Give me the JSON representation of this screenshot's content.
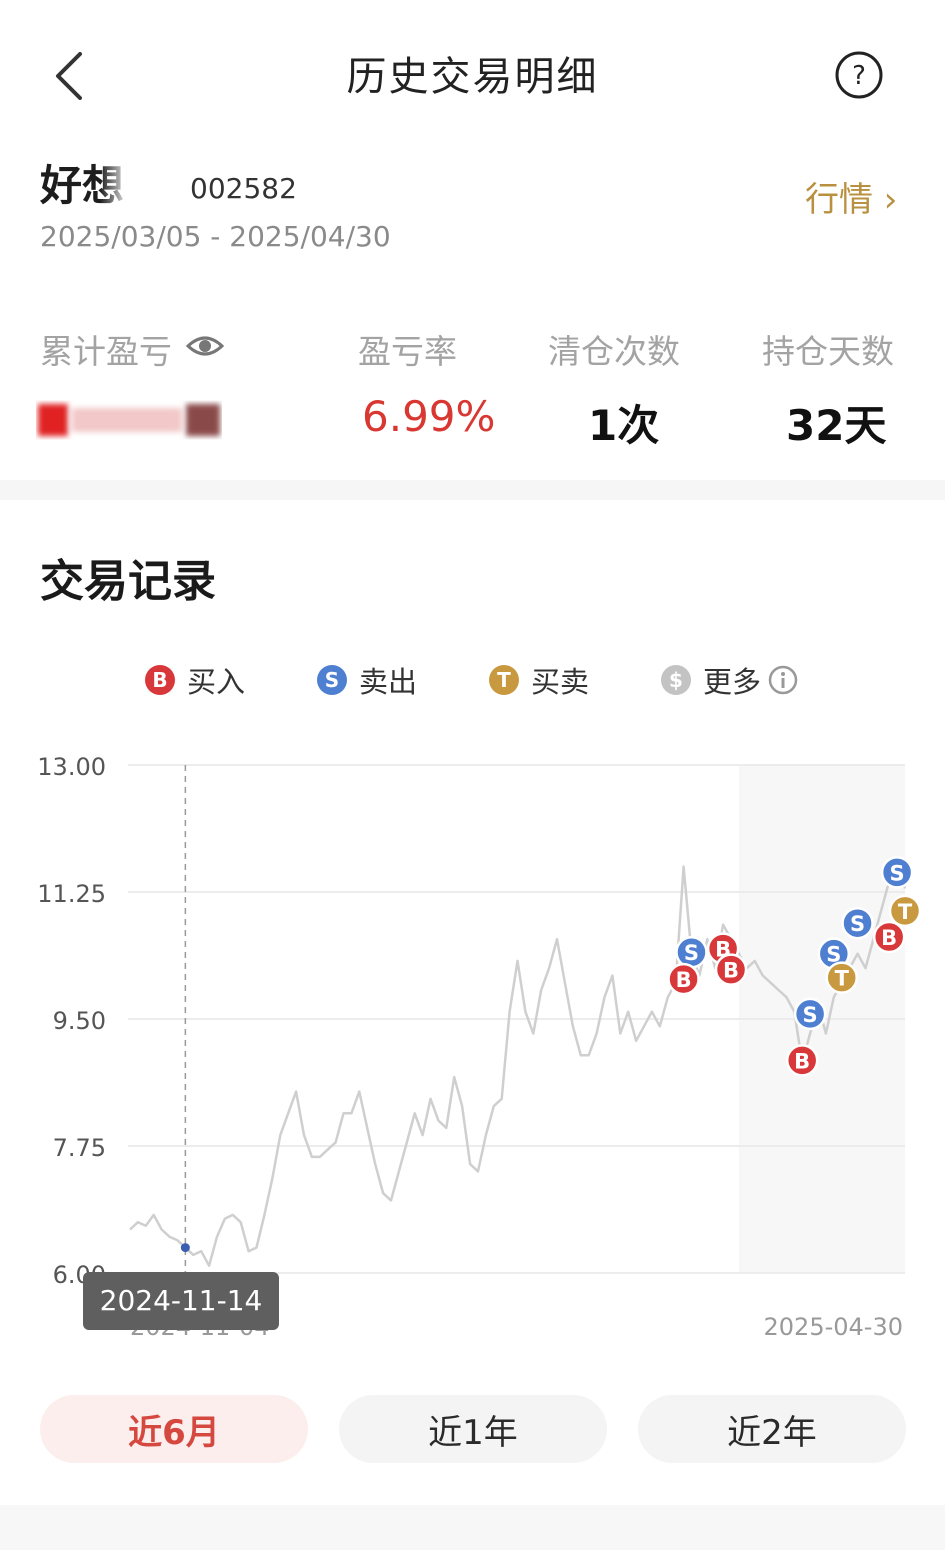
{
  "header": {
    "title": "历史交易明细",
    "back_icon": "chevron-left-icon",
    "help_icon": "question-circle-icon"
  },
  "stock": {
    "name": "好想",
    "code": "002582",
    "date_range": "2025/03/05 - 2025/04/30",
    "market_link": "行情 ›"
  },
  "stats": {
    "pnl_label": "累计盈亏",
    "pnl_value": "",
    "rate_label": "盈亏率",
    "rate_value": "6.99%",
    "clear_label": "清仓次数",
    "clear_value": "1次",
    "days_label": "持仓天数",
    "days_value": "32天"
  },
  "section": {
    "title": "交易记录"
  },
  "legend": [
    {
      "marker": "B",
      "label": "买入",
      "color": "#d9383a"
    },
    {
      "marker": "S",
      "label": "卖出",
      "color": "#4f7fd1"
    },
    {
      "marker": "T",
      "label": "买卖",
      "color": "#c9993f"
    },
    {
      "marker": "$",
      "label": "更多",
      "color": "#c3c3c3"
    }
  ],
  "chart_data": {
    "type": "line",
    "ylim": [
      6.0,
      13.0
    ],
    "y_ticks": [
      "13.00",
      "11.25",
      "9.50",
      "7.75",
      "6.00"
    ],
    "x_start_label": "2024-11-04",
    "x_end_label": "2025-04-30",
    "tooltip_date": "2024-11-14",
    "line_color": "#cfcfcf",
    "values": [
      6.6,
      6.7,
      6.65,
      6.8,
      6.6,
      6.5,
      6.45,
      6.35,
      6.25,
      6.3,
      6.1,
      6.5,
      6.75,
      6.8,
      6.7,
      6.3,
      6.35,
      6.8,
      7.3,
      7.9,
      8.2,
      8.5,
      7.9,
      7.6,
      7.6,
      7.7,
      7.8,
      8.2,
      8.2,
      8.5,
      8.0,
      7.5,
      7.1,
      7.0,
      7.4,
      7.8,
      8.2,
      7.9,
      8.4,
      8.1,
      8.0,
      8.7,
      8.3,
      7.5,
      7.4,
      7.9,
      8.3,
      8.4,
      9.6,
      10.3,
      9.6,
      9.3,
      9.9,
      10.2,
      10.6,
      10.0,
      9.4,
      9.0,
      9.0,
      9.3,
      9.8,
      10.1,
      9.3,
      9.6,
      9.2,
      9.4,
      9.6,
      9.4,
      9.8,
      10.0,
      11.6,
      10.4,
      10.1,
      10.6,
      10.2,
      10.8,
      10.6,
      10.4,
      10.2,
      10.3,
      10.1,
      10.0,
      9.9,
      9.8,
      9.6,
      8.9,
      9.3,
      9.7,
      9.3,
      9.8,
      10.0,
      10.2,
      10.4,
      10.2,
      10.6,
      11.0,
      11.4,
      11.7,
      11.3
    ],
    "shaded_from_index": 77,
    "trades": [
      {
        "type": "S",
        "date_index": 71,
        "price": 10.42
      },
      {
        "type": "B",
        "date_index": 70,
        "price": 10.05
      },
      {
        "type": "B",
        "date_index": 75,
        "price": 10.47
      },
      {
        "type": "B",
        "date_index": 76,
        "price": 10.18
      },
      {
        "type": "B",
        "date_index": 85,
        "price": 8.93
      },
      {
        "type": "S",
        "date_index": 86,
        "price": 9.57
      },
      {
        "type": "S",
        "date_index": 89,
        "price": 10.4
      },
      {
        "type": "T",
        "date_index": 90,
        "price": 10.07
      },
      {
        "type": "S",
        "date_index": 92,
        "price": 10.82
      },
      {
        "type": "B",
        "date_index": 96,
        "price": 10.63
      },
      {
        "type": "S",
        "date_index": 97,
        "price": 11.52
      },
      {
        "type": "T",
        "date_index": 98,
        "price": 10.99
      }
    ]
  },
  "ranges": [
    {
      "label": "近6月",
      "active": true
    },
    {
      "label": "近1年",
      "active": false
    },
    {
      "label": "近2年",
      "active": false
    }
  ]
}
